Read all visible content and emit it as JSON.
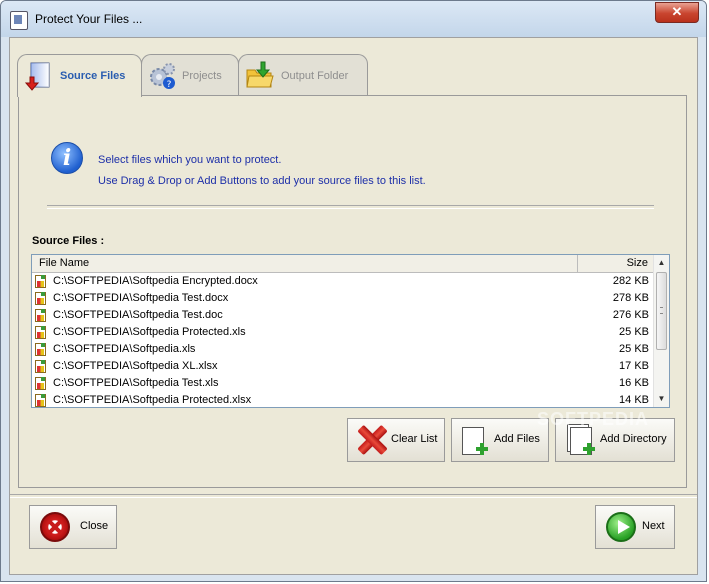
{
  "window": {
    "title": "Protect Your Files ...",
    "close_glyph": "✕"
  },
  "tabs": [
    {
      "label": "Source Files",
      "icon": "document-arrow-icon",
      "active": true
    },
    {
      "label": "Projects",
      "icon": "gears-icon",
      "active": false
    },
    {
      "label": "Output Folder",
      "icon": "folder-download-icon",
      "active": false
    }
  ],
  "info": {
    "icon_glyph": "i",
    "line1": "Select files which you want to protect.",
    "line2": "Use Drag & Drop or Add Buttons to add your source files to this list."
  },
  "source": {
    "label": "Source Files :",
    "columns": {
      "name": "File Name",
      "size": "Size"
    },
    "files": [
      {
        "name": "C:\\SOFTPEDIA\\Softpedia Encrypted.docx",
        "size": "282 KB"
      },
      {
        "name": "C:\\SOFTPEDIA\\Softpedia Test.docx",
        "size": "278 KB"
      },
      {
        "name": "C:\\SOFTPEDIA\\Softpedia Test.doc",
        "size": "276 KB"
      },
      {
        "name": "C:\\SOFTPEDIA\\Softpedia Protected.xls",
        "size": "25 KB"
      },
      {
        "name": "C:\\SOFTPEDIA\\Softpedia.xls",
        "size": "25 KB"
      },
      {
        "name": "C:\\SOFTPEDIA\\Softpedia XL.xlsx",
        "size": "17 KB"
      },
      {
        "name": "C:\\SOFTPEDIA\\Softpedia Test.xls",
        "size": "16 KB"
      },
      {
        "name": "C:\\SOFTPEDIA\\Softpedia Protected.xlsx",
        "size": "14 KB"
      }
    ],
    "scroll_up": "▲",
    "scroll_down": "▼"
  },
  "buttons": {
    "clear_list": "Clear List",
    "add_files": "Add Files",
    "add_directory": "Add Directory",
    "close": "Close",
    "next": "Next"
  },
  "watermark": "SOFTPEDIA",
  "colors": {
    "info_text": "#1d2fa8",
    "active_tab_text": "#2a5db0",
    "face": "#ece9d8"
  }
}
